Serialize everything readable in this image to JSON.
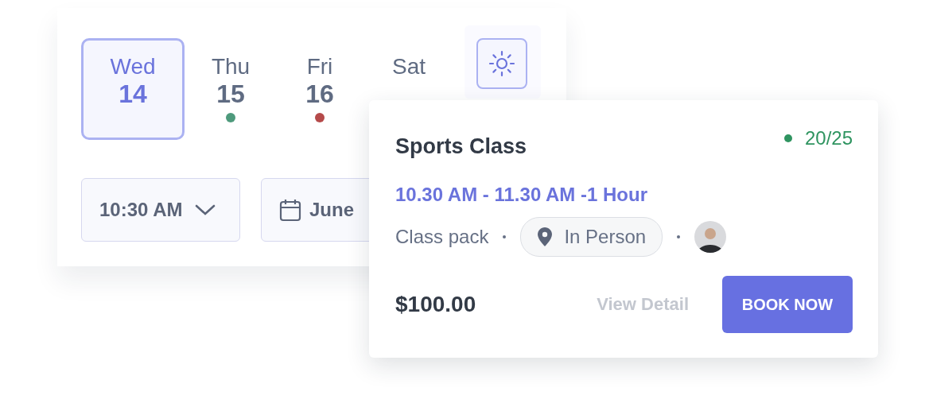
{
  "days": [
    {
      "weekday": "Wed",
      "date": "14",
      "selected": true
    },
    {
      "weekday": "Thu",
      "date": "15",
      "selected": false,
      "color": "#4e9a7c"
    },
    {
      "weekday": "Fri",
      "date": "16",
      "selected": false,
      "color": "#b54a4a"
    },
    {
      "weekday": "Sat",
      "selected": false
    }
  ],
  "time_select": {
    "value": "10:30 AM"
  },
  "month_select": {
    "value": "June"
  },
  "class_card": {
    "title": "Sports Class",
    "capacity": "20/25",
    "time": "10.30 AM - 11.30 AM -1 Hour",
    "pack": "Class pack",
    "location": "In Person",
    "price": "$100.00",
    "link": "View Detail",
    "button": "BOOK NOW"
  }
}
